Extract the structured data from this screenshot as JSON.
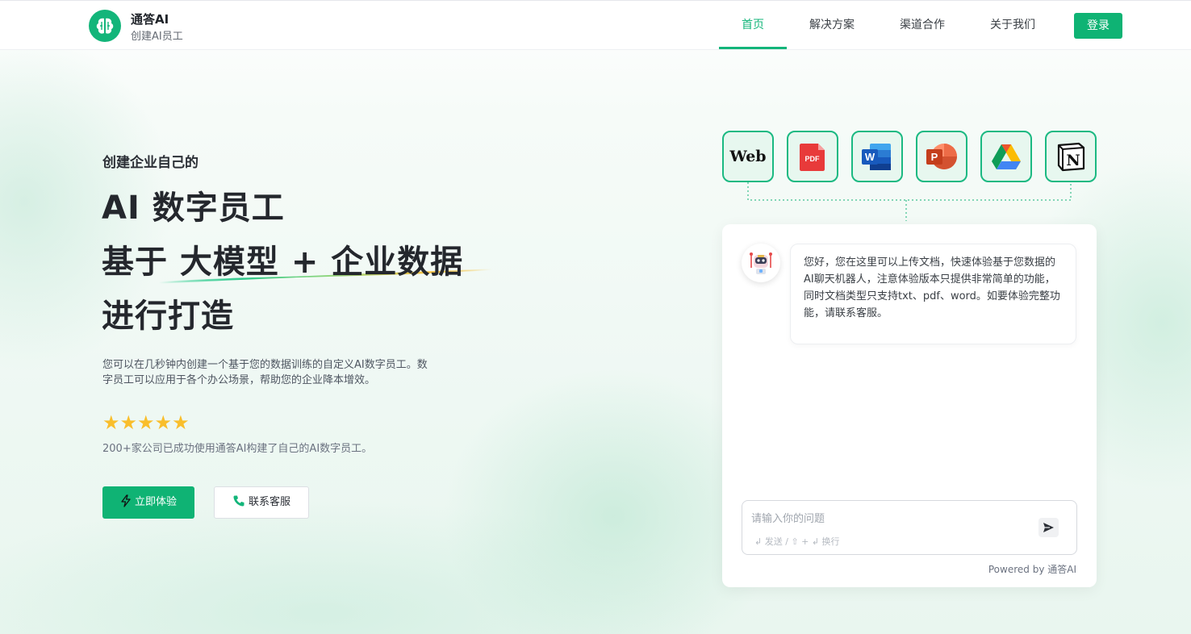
{
  "header": {
    "brand_name": "通答AI",
    "brand_tagline": "创建AI员工",
    "nav": [
      {
        "label": "首页",
        "active": true
      },
      {
        "label": "解决方案",
        "active": false
      },
      {
        "label": "渠道合作",
        "active": false
      },
      {
        "label": "关于我们",
        "active": false
      }
    ],
    "login_label": "登录"
  },
  "hero": {
    "eyebrow": "创建企业自己的",
    "headline_1": "AI 数字员工",
    "headline_2": "基于 大模型 + 企业数据",
    "headline_3": "进行打造",
    "description": "您可以在几秒钟内创建一个基于您的数据训练的自定义AI数字员工。数字员工可以应用于各个办公场景，帮助您的企业降本增效。",
    "rating_stars": 5,
    "social_proof": "200+家公司已成功使用通答AI构建了自己的AI数字员工。",
    "primary_button": "立即体验",
    "secondary_button": "联系客服"
  },
  "sources": [
    {
      "name": "web",
      "label": "Web"
    },
    {
      "name": "pdf",
      "label": "PDF"
    },
    {
      "name": "word",
      "label": "W"
    },
    {
      "name": "powerpoint",
      "label": "P"
    },
    {
      "name": "google-drive",
      "label": ""
    },
    {
      "name": "notion",
      "label": "N"
    }
  ],
  "chat": {
    "greeting": "您好，您在这里可以上传文档，快速体验基于您数据的AI聊天机器人，注意体验版本只提供非常简单的功能，同时文档类型只支持txt、pdf、word。如要体验完整功能，请联系客服。",
    "input_placeholder": "请输入你的问题",
    "input_hint": "↲ 发送 / ⇧ + ↲ 换行",
    "powered_by": "Powered by 通答AI"
  },
  "colors": {
    "brand": "#0fb374",
    "star": "#f9be2c",
    "text_dark": "#24272d"
  }
}
